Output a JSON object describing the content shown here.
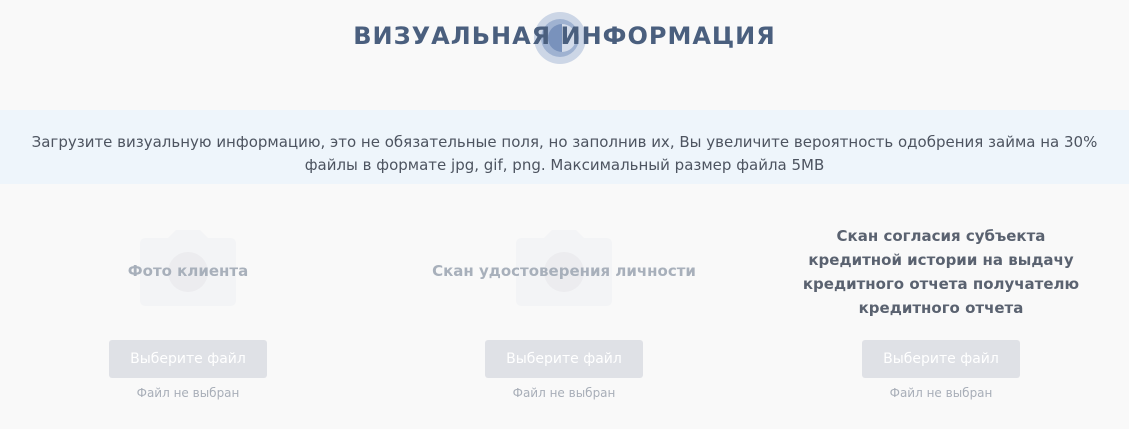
{
  "header": {
    "title": "ВИЗУАЛЬНАЯ ИНФОРМАЦИЯ"
  },
  "info": {
    "line1": "Загрузите визуальную информацию, это не обязательные поля, но заполнив их, Вы увеличите вероятность одобрения займа на 30%",
    "line2": "файлы в формате jpg, gif, png. Максимальный размер файла 5MB"
  },
  "uploads": [
    {
      "label": "Фото клиента",
      "button_label": "Выберите файл",
      "status": "Файл не выбран",
      "icon": "camera-icon"
    },
    {
      "label": "Скан удостоверения личности",
      "button_label": "Выберите файл",
      "status": "Файл не выбран",
      "icon": "camera-icon"
    },
    {
      "label_lines": [
        "Скан согласия субъекта",
        "кредитной истории на выдачу",
        "кредитного отчета получателю",
        "кредитного отчета"
      ],
      "button_label": "Выберите файл",
      "status": "Файл не выбран"
    }
  ],
  "colors": {
    "title": "#4a5f7e",
    "band": "#eef5fb",
    "button": "#dfe1e6"
  }
}
